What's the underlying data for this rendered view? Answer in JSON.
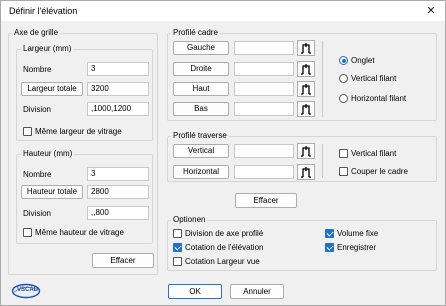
{
  "window": {
    "title": "Définir l'élévation",
    "close_glyph": "✕"
  },
  "axe_grille": {
    "title": "Axe de grille",
    "largeur": {
      "title": "Largeur (mm)",
      "nombre_label": "Nombre",
      "nombre_value": "3",
      "total_button": "Largeur totale",
      "total_value": "3200",
      "division_label": "Division",
      "division_value": ",1000,1200",
      "same_checkbox": "Même largeur de vitrage",
      "same_checked": false
    },
    "hauteur": {
      "title": "Hauteur (mm)",
      "nombre_label": "Nombre",
      "nombre_value": "3",
      "total_button": "Hauteur totale",
      "total_value": "2800",
      "division_label": "Division",
      "division_value": ",,800",
      "same_checkbox": "Même hauteur de vitrage",
      "same_checked": false
    },
    "effacer": "Effacer"
  },
  "profile_cadre": {
    "title": "Profilé cadre",
    "rows": [
      {
        "label": "Gauche",
        "value": ""
      },
      {
        "label": "Droite",
        "value": ""
      },
      {
        "label": "Haut",
        "value": ""
      },
      {
        "label": "Bas",
        "value": ""
      }
    ],
    "options": [
      {
        "label": "Onglet",
        "selected": true
      },
      {
        "label": "Vertical filant",
        "selected": false
      },
      {
        "label": "Horizontal filant",
        "selected": false
      }
    ]
  },
  "profile_traverse": {
    "title": "Profilé traverse",
    "rows": [
      {
        "label": "Vertical",
        "value": ""
      },
      {
        "label": "Horizontal",
        "value": ""
      }
    ],
    "checks": [
      {
        "label": "Vertical filant",
        "checked": false
      },
      {
        "label": "Couper le cadre",
        "checked": false
      }
    ]
  },
  "effacer_right": "Effacer",
  "optionen": {
    "title": "Optionen",
    "items": [
      {
        "label": "Division de axe profilé",
        "checked": false
      },
      {
        "label": "Cotation de l'élévation",
        "checked": true
      },
      {
        "label": "Cotation Largeur vue",
        "checked": false
      },
      {
        "label": "Volume fixe",
        "checked": true
      },
      {
        "label": "Enregistrer",
        "checked": true
      }
    ]
  },
  "footer": {
    "ok": "OK",
    "annuler": "Annuler",
    "logo_text": "VSCAD"
  },
  "colors": {
    "accent": "#1c6fd3",
    "logo_blue": "#1f4fb5"
  }
}
